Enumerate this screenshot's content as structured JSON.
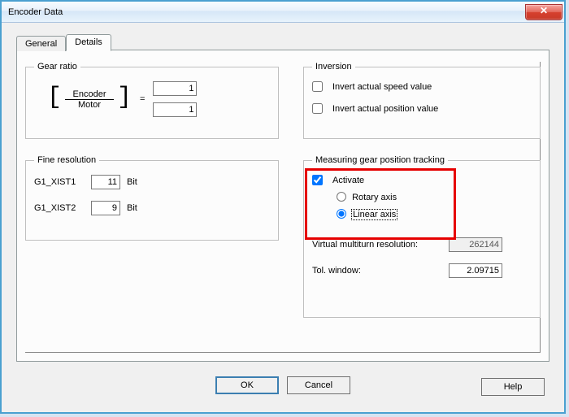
{
  "window": {
    "title": "Encoder Data"
  },
  "tabs": {
    "general": "General",
    "details": "Details"
  },
  "gear_ratio": {
    "legend": "Gear ratio",
    "encoder_label": "Encoder",
    "motor_label": "Motor",
    "eq": "=",
    "encoder_value": "1",
    "motor_value": "1"
  },
  "fine_res": {
    "legend": "Fine resolution",
    "xist1_label": "G1_XIST1",
    "xist1_value": "11",
    "xist2_label": "G1_XIST2",
    "xist2_value": "9",
    "unit": "Bit"
  },
  "inversion": {
    "legend": "Inversion",
    "speed_label": "Invert actual speed value",
    "speed_checked": false,
    "position_label": "Invert actual position value",
    "position_checked": false
  },
  "measuring": {
    "legend": "Measuring gear position tracking",
    "activate_label": "Activate",
    "activate_checked": true,
    "rotary_label": "Rotary axis",
    "linear_label": "Linear axis",
    "axis_selected": "linear",
    "virtual_label": "Virtual multiturn resolution:",
    "virtual_value": "262144",
    "tol_label": "Tol. window:",
    "tol_value": "2.09715"
  },
  "buttons": {
    "ok": "OK",
    "cancel": "Cancel",
    "help": "Help"
  }
}
